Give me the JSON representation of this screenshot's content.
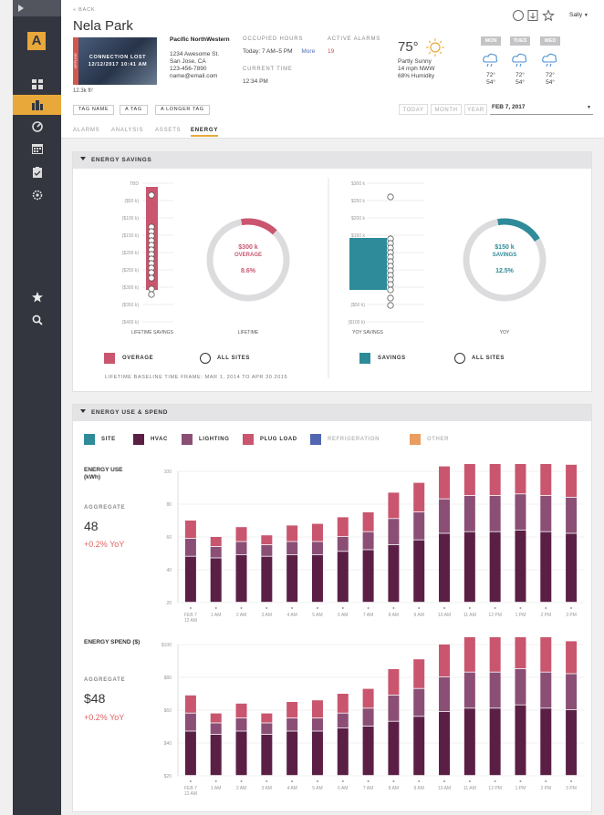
{
  "nav": {
    "items": [
      "layers-icon",
      "buildings-icon",
      "gauge-icon",
      "calendar-icon",
      "clipboard-icon",
      "settings-icon",
      "star-icon",
      "search-icon"
    ]
  },
  "header": {
    "back": "« BACK",
    "title": "Nela Park",
    "area": "12.3k ft²",
    "image_banner": "CONNECTION LOST",
    "image_date": "12/12/2017 10:41 AM",
    "image_side_label": "OFFLINE",
    "org_name": "Pacific NorthWestern",
    "addr1": "1234 Awesome St.",
    "addr2": "San Jose, CA",
    "phone": "123-456-7890",
    "email": "name@email.com",
    "occupied_label": "OCCUPIED HOURS",
    "occupied_value": "Today: 7 AM–5 PM",
    "more": "More",
    "current_time_label": "CURRENT TIME",
    "current_time": "12:34 PM",
    "alarms_label": "ACTIVE ALARMS",
    "alarms_value": "19",
    "weather": {
      "temp": "75°",
      "cond": "Partly Sunny",
      "wind": "14 mph NWW",
      "humidity": "68% Humidity",
      "days": [
        {
          "name": "MON",
          "hi": "72°",
          "lo": "54°"
        },
        {
          "name": "TUES",
          "hi": "72°",
          "lo": "54°"
        },
        {
          "name": "WED",
          "hi": "72°",
          "lo": "54°"
        }
      ]
    },
    "user": "Sally",
    "tags": [
      "TAG NAME",
      "A TAG",
      "A LONGER TAG"
    ],
    "ranges": [
      "TODAY",
      "MONTH",
      "YEAR"
    ],
    "date": "FEB 7, 2017",
    "tabs": [
      "ALARMS",
      "ANALYSIS",
      "ASSETS",
      "ENERGY"
    ],
    "active_tab": "ENERGY"
  },
  "savings_panel": {
    "title": "ENERGY SAVINGS",
    "lifetime": {
      "ticks": [
        "TBD",
        "($50 k)",
        "($100 k)",
        "($150 k)",
        "($200 k)",
        "($250 k)",
        "($300 k)",
        "($350 k)",
        "($400 k)"
      ],
      "bar_label": "LIFETIME SAVINGS",
      "donut_value": "$300 k",
      "donut_word": "OVERAGE",
      "donut_pct": "8.6%",
      "donut_caption": "LIFETIME",
      "donut_fraction": 0.15,
      "legend": [
        "OVERAGE",
        "ALL SITES"
      ]
    },
    "yoy": {
      "ticks": [
        "$300 k",
        "$250 k",
        "$200 k",
        "$150 k",
        "$100 k",
        "$50 k",
        "$0",
        "($50 k)",
        "($100 k)"
      ],
      "bar_label": "YOY SAVINGS",
      "donut_value": "$150 k",
      "donut_word": "SAVINGS",
      "donut_pct": "12.5%",
      "donut_caption": "YOY",
      "donut_fraction": 0.19,
      "legend": [
        "SAVINGS",
        "ALL SITES"
      ]
    },
    "footnote": "LIFETIME BASELINE TIME FRAME: MAR 1, 2014 TO APR 30 2015"
  },
  "use_panel": {
    "title": "ENERGY USE & SPEND",
    "legend": [
      {
        "label": "SITE",
        "color": "#2e8b99",
        "on": true
      },
      {
        "label": "HVAC",
        "color": "#5b1f45",
        "on": true
      },
      {
        "label": "LIGHTING",
        "color": "#8b4f76",
        "on": true
      },
      {
        "label": "PLUG LOAD",
        "color": "#c9566e",
        "on": true
      },
      {
        "label": "REFRIGERATION",
        "color": "#3e57a8",
        "on": false
      },
      {
        "label": "OTHER",
        "color": "#e8924f",
        "on": false
      }
    ],
    "use_title": "ENERGY USE (kWh)",
    "spend_title": "ENERGY SPEND ($)",
    "aggregate_label": "AGGREGATE",
    "use_value": "48",
    "use_change": "+0.2% YoY",
    "spend_value": "$48",
    "spend_change": "+0.2% YoY"
  },
  "chart_data": [
    {
      "type": "bar",
      "title": "ENERGY USE (kWh)",
      "categories": [
        "FEB 7 12 AM",
        "1 AM",
        "2 AM",
        "3 AM",
        "4 AM",
        "5 AM",
        "6 AM",
        "7 AM",
        "8 AM",
        "9 AM",
        "10 AM",
        "11 AM",
        "12 PM",
        "1 PM",
        "2 PM",
        "3 PM"
      ],
      "yticks": [
        "20",
        "40",
        "60",
        "80",
        "100"
      ],
      "ylim": [
        20,
        100
      ],
      "series": [
        {
          "name": "HVAC",
          "values": [
            28,
            27,
            29,
            28,
            29,
            29,
            31,
            32,
            35,
            38,
            42,
            43,
            43,
            44,
            43,
            42
          ]
        },
        {
          "name": "LIGHTING",
          "values": [
            11,
            7,
            8,
            7,
            8,
            8,
            9,
            11,
            16,
            17,
            21,
            22,
            22,
            22,
            22,
            22
          ]
        },
        {
          "name": "PLUG LOAD",
          "values": [
            11,
            6,
            9,
            6,
            10,
            11,
            12,
            12,
            16,
            18,
            20,
            23,
            23,
            26,
            22,
            20
          ]
        }
      ]
    },
    {
      "type": "bar",
      "title": "ENERGY SPEND ($)",
      "categories": [
        "FEB 7 12 AM",
        "1 AM",
        "2 AM",
        "3 AM",
        "4 AM",
        "5 AM",
        "6 AM",
        "7 AM",
        "8 AM",
        "9 AM",
        "10 AM",
        "11 AM",
        "12 PM",
        "1 PM",
        "2 PM",
        "3 PM"
      ],
      "yticks": [
        "$20",
        "$40",
        "$60",
        "$80",
        "$100"
      ],
      "ylim": [
        20,
        100
      ],
      "series": [
        {
          "name": "HVAC",
          "values": [
            27,
            25,
            27,
            25,
            27,
            27,
            29,
            30,
            33,
            36,
            39,
            41,
            41,
            43,
            41,
            40
          ]
        },
        {
          "name": "LIGHTING",
          "values": [
            11,
            7,
            8,
            7,
            8,
            8,
            9,
            11,
            16,
            17,
            21,
            22,
            22,
            22,
            22,
            22
          ]
        },
        {
          "name": "PLUG LOAD",
          "values": [
            11,
            6,
            9,
            6,
            10,
            11,
            12,
            12,
            16,
            18,
            20,
            23,
            23,
            26,
            22,
            20
          ]
        }
      ]
    }
  ]
}
